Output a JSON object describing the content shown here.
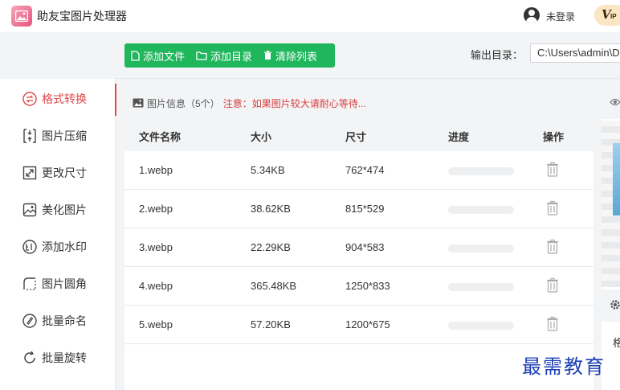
{
  "app": {
    "title": "助友宝图片处理器",
    "login_label": "未登录",
    "vip_label": "V",
    "vip_sub": "IP"
  },
  "toolbar": {
    "add_file": "添加文件",
    "add_dir": "添加目录",
    "clear_list": "清除列表",
    "output_label": "输出目录：",
    "output_value": "C:\\Users\\admin\\D"
  },
  "sidebar": {
    "items": [
      {
        "label": "格式转换",
        "icon": "format-convert-icon",
        "active": true
      },
      {
        "label": "图片压缩",
        "icon": "compress-icon"
      },
      {
        "label": "更改尺寸",
        "icon": "resize-icon"
      },
      {
        "label": "美化图片",
        "icon": "beautify-icon"
      },
      {
        "label": "添加水印",
        "icon": "watermark-icon"
      },
      {
        "label": "图片圆角",
        "icon": "round-corner-icon"
      },
      {
        "label": "批量命名",
        "icon": "rename-icon"
      },
      {
        "label": "批量旋转",
        "icon": "rotate-icon"
      }
    ]
  },
  "panel": {
    "info_label": "图片信息（5个）",
    "notice": "注意：如果图片较大请耐心等待..."
  },
  "table": {
    "headers": [
      "文件名称",
      "大小",
      "尺寸",
      "进度",
      "操作"
    ],
    "rows": [
      {
        "name": "1.webp",
        "size": "5.34KB",
        "dims": "762*474",
        "progress": 0
      },
      {
        "name": "2.webp",
        "size": "38.62KB",
        "dims": "815*529",
        "progress": 0
      },
      {
        "name": "3.webp",
        "size": "22.29KB",
        "dims": "904*583",
        "progress": 0
      },
      {
        "name": "4.webp",
        "size": "365.48KB",
        "dims": "1250*833",
        "progress": 0
      },
      {
        "name": "5.webp",
        "size": "57.20KB",
        "dims": "1200*675",
        "progress": 0
      }
    ]
  },
  "right_panel": {
    "format_label": "格"
  },
  "watermark": "最需教育",
  "colors": {
    "accent_green": "#1fb65c",
    "active_red": "#e04848",
    "notice_red": "#d93c3c"
  }
}
